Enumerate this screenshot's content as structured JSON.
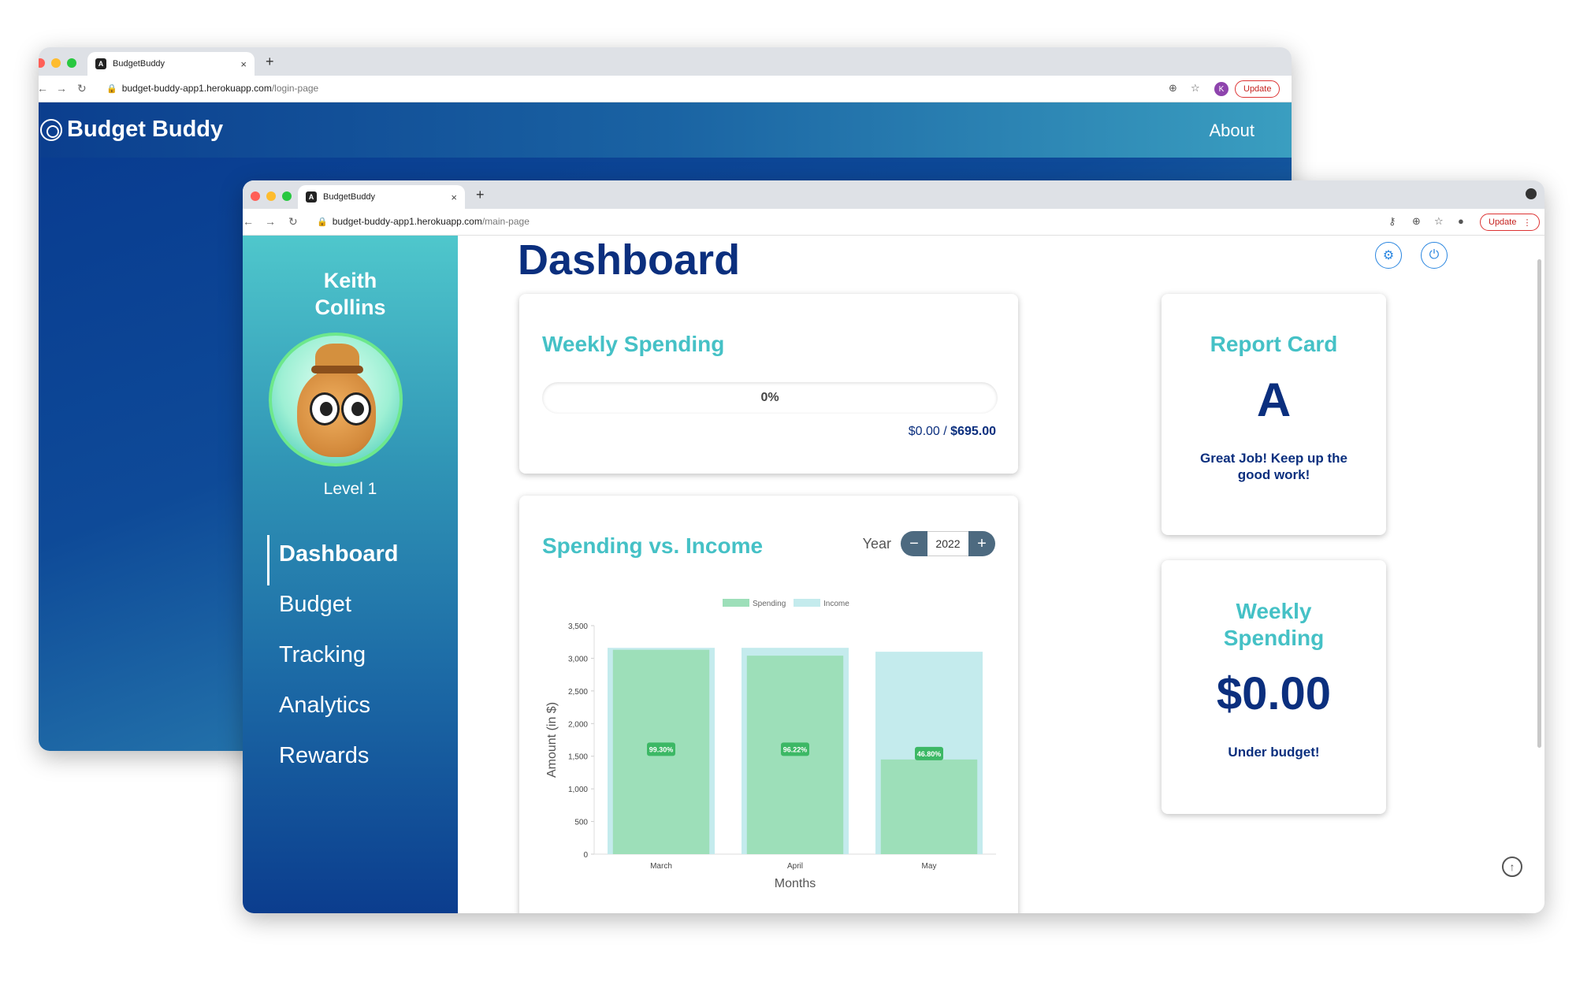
{
  "back_window": {
    "tab_title": "BudgetBuddy",
    "url_host": "budget-buddy-app1.herokuapp.com",
    "url_path": "/login-page",
    "update_label": "Update",
    "profile_initial": "K",
    "brand": "Budget Buddy",
    "about": "About"
  },
  "front_window": {
    "tab_title": "BudgetBuddy",
    "url_host": "budget-buddy-app1.herokuapp.com",
    "url_path": "/main-page",
    "update_label": "Update"
  },
  "sidebar": {
    "user_name": "Keith Collins",
    "level": "Level 1",
    "items": [
      {
        "label": "Dashboard",
        "active": true
      },
      {
        "label": "Budget"
      },
      {
        "label": "Tracking"
      },
      {
        "label": "Analytics"
      },
      {
        "label": "Rewards"
      }
    ]
  },
  "main": {
    "title": "Dashboard",
    "weekly_spending": {
      "title": "Weekly Spending",
      "progress_percent": 0,
      "progress_label": "0%",
      "spent": "$0.00",
      "separator": " / ",
      "budget": "$695.00"
    },
    "spending_vs_income": {
      "title": "Spending vs. Income",
      "year_label": "Year",
      "year": "2022",
      "minus": "−",
      "plus": "+"
    },
    "report_card": {
      "title": "Report Card",
      "grade": "A",
      "message": "Great Job! Keep up the good work!"
    },
    "weekly_summary": {
      "title": "Weekly Spending",
      "amount": "$0.00",
      "status": "Under budget!"
    }
  },
  "chart_data": {
    "type": "bar",
    "categories": [
      "March",
      "April",
      "May"
    ],
    "series": [
      {
        "name": "Spending",
        "values": [
          3130,
          3040,
          1450
        ],
        "color": "#9ddfb9"
      },
      {
        "name": "Income",
        "values": [
          3160,
          3160,
          3100
        ],
        "color": "#c4ebed"
      }
    ],
    "data_labels": [
      "99.30%",
      "96.22%",
      "46.80%"
    ],
    "xlabel": "Months",
    "ylabel": "Amount (in $)",
    "ylim": [
      0,
      3500
    ],
    "yticks": [
      "0",
      "500",
      "1,000",
      "1,500",
      "2,000",
      "2,500",
      "3,000",
      "3,500"
    ],
    "ytick_values": [
      0,
      500,
      1000,
      1500,
      2000,
      2500,
      3000,
      3500
    ],
    "legend_position": "top-center",
    "label_color": "#3cb865"
  }
}
